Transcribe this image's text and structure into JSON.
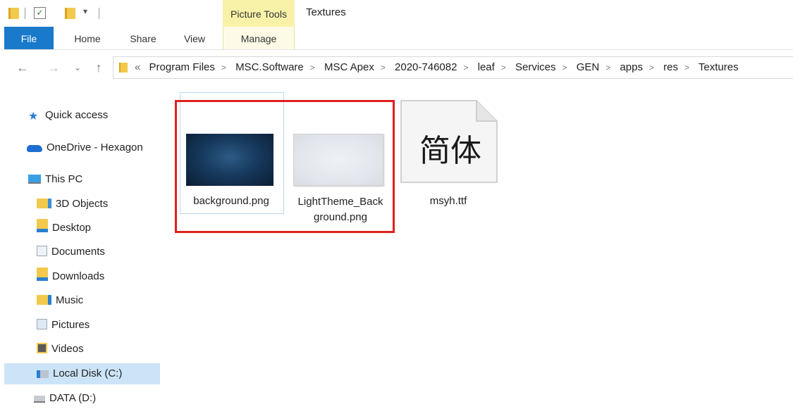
{
  "window": {
    "title": "Textures"
  },
  "ribbon": {
    "context_group": "Picture Tools",
    "tabs": [
      {
        "label": "File"
      },
      {
        "label": "Home"
      },
      {
        "label": "Share"
      },
      {
        "label": "View"
      },
      {
        "label": "Manage"
      }
    ]
  },
  "address": {
    "overflow": "«",
    "crumbs": [
      "Program Files",
      "MSC.Software",
      "MSC Apex",
      "2020-746082",
      "leaf",
      "Services",
      "GEN",
      "apps",
      "res",
      "Textures"
    ]
  },
  "nav": {
    "items": [
      {
        "label": "Quick access",
        "icon": "star-icon"
      },
      {
        "label": "OneDrive - Hexagon",
        "icon": "cloud-icon"
      },
      {
        "label": "This PC",
        "icon": "computer-icon"
      },
      {
        "label": "3D Objects",
        "icon": "3d-objects-folder-icon"
      },
      {
        "label": "Desktop",
        "icon": "desktop-folder-icon"
      },
      {
        "label": "Documents",
        "icon": "documents-folder-icon"
      },
      {
        "label": "Downloads",
        "icon": "downloads-folder-icon"
      },
      {
        "label": "Music",
        "icon": "music-folder-icon"
      },
      {
        "label": "Pictures",
        "icon": "pictures-folder-icon"
      },
      {
        "label": "Videos",
        "icon": "videos-folder-icon"
      },
      {
        "label": "Local Disk (C:)",
        "icon": "local-disk-icon"
      },
      {
        "label": "DATA (D:)",
        "icon": "drive-icon"
      }
    ]
  },
  "files": [
    {
      "name": "background.png",
      "type": "image"
    },
    {
      "name_line1": "LightTheme_Back",
      "name_line2": "ground.png",
      "type": "image"
    },
    {
      "name": "msyh.ttf",
      "type": "font",
      "glyphs": "简体"
    }
  ],
  "colors": {
    "accent": "#1979ca",
    "context_tab": "#f8f2a8",
    "highlight": "#e02020",
    "selection": "#cce4f7"
  }
}
